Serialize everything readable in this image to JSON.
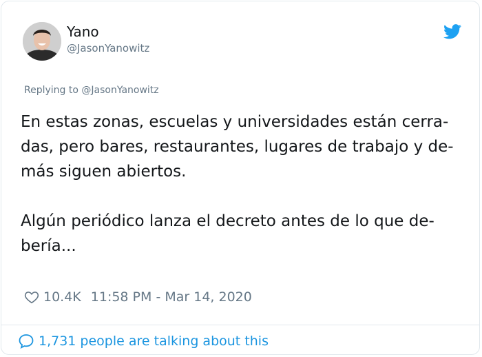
{
  "author": {
    "name": "Yano",
    "handle": "@JasonYanowitz",
    "avatar_icon": "profile-photo"
  },
  "replying_to": "Replying to @JasonYanowitz",
  "tweet": {
    "paragraph1_lines": [
      "En estas zonas, escuelas y universidades están cerra-",
      "das, pero bares, restaurantes, lugares de trabajo y de-",
      "más siguen abiertos."
    ],
    "paragraph2_lines": [
      "Algún periódico lanza el decreto antes de lo que de-",
      "bería..."
    ]
  },
  "stats": {
    "likes": "10.4K",
    "timestamp": "11:58 PM - Mar 14, 2020"
  },
  "conversation": {
    "label": "1,731 people are talking about this"
  },
  "colors": {
    "brand": "#1da1f2",
    "link": "#1b95e0",
    "secondary_text": "#657786"
  }
}
